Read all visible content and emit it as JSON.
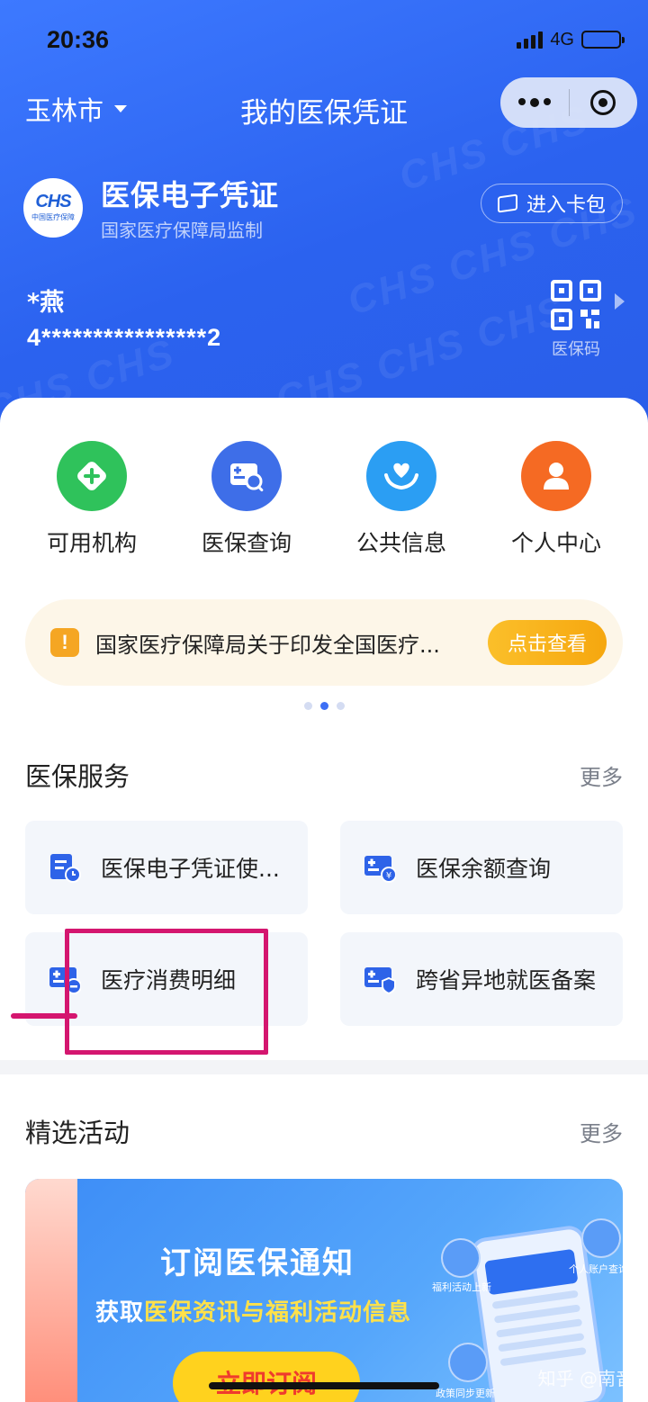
{
  "status_bar": {
    "time": "20:36",
    "network": "4G"
  },
  "navbar": {
    "city": "玉林市",
    "title": "我的医保凭证"
  },
  "card": {
    "logo_text": "CHS",
    "logo_subtext": "中国医疗保障",
    "title": "医保电子凭证",
    "subtitle": "国家医疗保障局监制",
    "card_bag_label": "进入卡包",
    "holder_name": "*燕",
    "id_number": "4****************2",
    "qr_label": "医保码"
  },
  "shortcuts": [
    {
      "label": "可用机构",
      "icon": "plus-diamond-icon",
      "color": "#2fc25b"
    },
    {
      "label": "医保查询",
      "icon": "card-search-icon",
      "color": "#3e6ee8"
    },
    {
      "label": "公共信息",
      "icon": "heart-hands-icon",
      "color": "#2b9ef3"
    },
    {
      "label": "个人中心",
      "icon": "person-icon",
      "color": "#f56a23"
    }
  ],
  "notice": {
    "text": "国家医疗保障局关于印发全国医疗...",
    "button": "点击查看"
  },
  "services": {
    "title": "医保服务",
    "more": "更多",
    "items": [
      {
        "label": "医保电子凭证使...",
        "icon": "document-clock-icon"
      },
      {
        "label": "医保余额查询",
        "icon": "card-yen-icon"
      },
      {
        "label": "医疗消费明细",
        "icon": "card-minus-icon"
      },
      {
        "label": "跨省异地就医备案",
        "icon": "card-shield-icon"
      }
    ]
  },
  "activities": {
    "title": "精选活动",
    "more": "更多",
    "banner": {
      "title": "订阅医保通知",
      "subtitle_prefix": "获取",
      "subtitle_highlight": "医保资讯与福利活动信息",
      "button": "立即订阅",
      "bubble_1": "福利活动上新",
      "bubble_2": "个人账户查询",
      "bubble_3": "政策同步更新"
    }
  },
  "watermark": "知乎 @南音"
}
